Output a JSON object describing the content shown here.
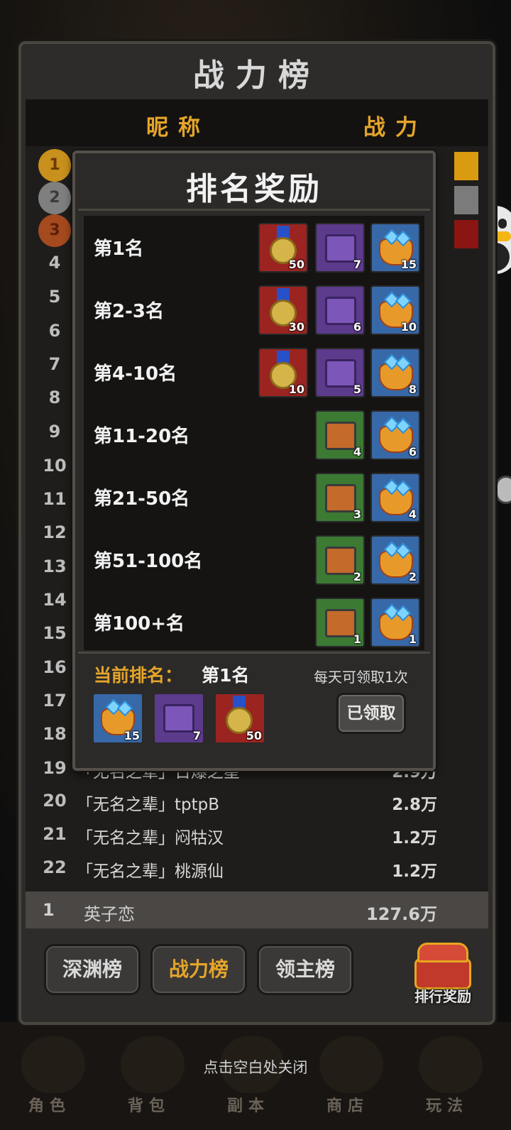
{
  "panel": {
    "title": "战力榜",
    "col_name": "昵称",
    "col_power": "战力"
  },
  "leaderboard": {
    "rows": [
      {
        "rank": "4"
      },
      {
        "rank": "5"
      },
      {
        "rank": "6"
      },
      {
        "rank": "7"
      },
      {
        "rank": "8"
      },
      {
        "rank": "9"
      },
      {
        "rank": "10"
      },
      {
        "rank": "11"
      },
      {
        "rank": "12"
      },
      {
        "rank": "13"
      },
      {
        "rank": "14"
      },
      {
        "rank": "15"
      },
      {
        "rank": "16"
      },
      {
        "rank": "17"
      },
      {
        "rank": "18"
      },
      {
        "rank": "19",
        "name": "「无名之辈」日爆之星",
        "power": "2.9万"
      },
      {
        "rank": "20",
        "name": "「无名之辈」tptpB",
        "power": "2.8万"
      },
      {
        "rank": "21",
        "name": "「无名之辈」闷牯汉",
        "power": "1.2万"
      },
      {
        "rank": "22",
        "name": "「无名之辈」桃源仙",
        "power": "1.2万"
      }
    ],
    "medals": [
      "1",
      "2",
      "3"
    ],
    "self": {
      "rank": "1",
      "name": "英子恋",
      "power": "127.6万"
    }
  },
  "tabs": [
    "深渊榜",
    "战力榜",
    "领主榜"
  ],
  "reward_button": "排行奖励",
  "dialog": {
    "title": "排名奖励",
    "tiers": [
      {
        "label": "第1名",
        "items": [
          {
            "icon": "medal",
            "qty": "50"
          },
          {
            "icon": "purple-chest",
            "qty": "7"
          },
          {
            "icon": "gem-bag",
            "qty": "15"
          }
        ]
      },
      {
        "label": "第2-3名",
        "items": [
          {
            "icon": "medal",
            "qty": "30"
          },
          {
            "icon": "purple-chest",
            "qty": "6"
          },
          {
            "icon": "gem-bag",
            "qty": "10"
          }
        ]
      },
      {
        "label": "第4-10名",
        "items": [
          {
            "icon": "medal",
            "qty": "10"
          },
          {
            "icon": "purple-chest",
            "qty": "5"
          },
          {
            "icon": "gem-bag",
            "qty": "8"
          }
        ]
      },
      {
        "label": "第11-20名",
        "items": [
          {
            "icon": "green-chest",
            "qty": "4"
          },
          {
            "icon": "gem-bag",
            "qty": "6"
          }
        ]
      },
      {
        "label": "第21-50名",
        "items": [
          {
            "icon": "green-chest",
            "qty": "3"
          },
          {
            "icon": "gem-bag",
            "qty": "4"
          }
        ]
      },
      {
        "label": "第51-100名",
        "items": [
          {
            "icon": "green-chest",
            "qty": "2"
          },
          {
            "icon": "gem-bag",
            "qty": "2"
          }
        ]
      },
      {
        "label": "第100+名",
        "items": [
          {
            "icon": "green-chest",
            "qty": "1"
          },
          {
            "icon": "gem-bag",
            "qty": "1"
          }
        ]
      }
    ],
    "current_label": "当前排名：",
    "current_value": "第1名",
    "daily_note": "每天可领取1次",
    "current_items": [
      {
        "icon": "gem-bag",
        "qty": "15"
      },
      {
        "icon": "purple-chest",
        "qty": "7"
      },
      {
        "icon": "medal",
        "qty": "50"
      }
    ],
    "claimed_button": "已领取"
  },
  "close_hint": "点击空白处关闭",
  "bottom_nav": [
    "角色",
    "背包",
    "副本",
    "商店",
    "玩法"
  ]
}
